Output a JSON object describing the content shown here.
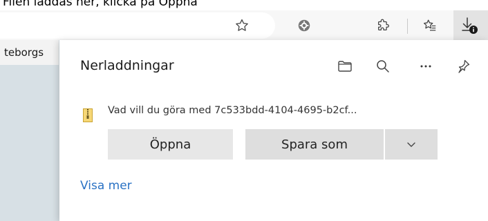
{
  "caption": {
    "text": "Filen laddas ner, klicka på Öppna"
  },
  "tabs": {
    "left_tab_label": "teborgs"
  },
  "toolbar": {
    "icons": [
      "star-icon",
      "extension-badge-icon",
      "puzzle-icon",
      "favorites-icon",
      "download-icon"
    ]
  },
  "downloads": {
    "title": "Nerladdningar",
    "item": {
      "prompt": "Vad vill du göra med 7c533bdd-4104-4695-b2cf...",
      "open_label": "Öppna",
      "save_as_label": "Spara som"
    },
    "show_more": "Visa mer"
  }
}
